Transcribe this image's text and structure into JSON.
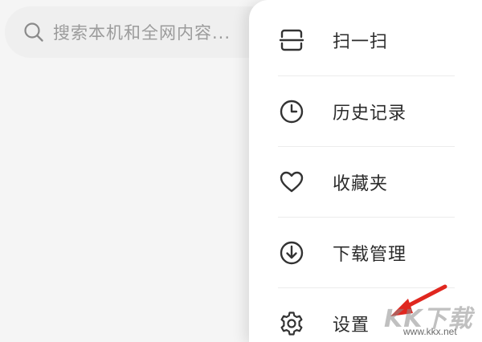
{
  "search": {
    "placeholder": "搜索本机和全网内容..."
  },
  "menu": {
    "items": [
      {
        "label": "扫一扫",
        "icon": "scan-icon"
      },
      {
        "label": "历史记录",
        "icon": "clock-icon"
      },
      {
        "label": "收藏夹",
        "icon": "heart-icon"
      },
      {
        "label": "下载管理",
        "icon": "download-icon"
      },
      {
        "label": "设置",
        "icon": "gear-icon"
      }
    ]
  },
  "watermark": {
    "logo_text": "KK下载",
    "site": "www.kkx.net"
  },
  "colors": {
    "annotation_arrow": "#e0271f",
    "icon_stroke": "#333333",
    "search_bg": "#efefef",
    "panel_bg": "#ffffff"
  }
}
